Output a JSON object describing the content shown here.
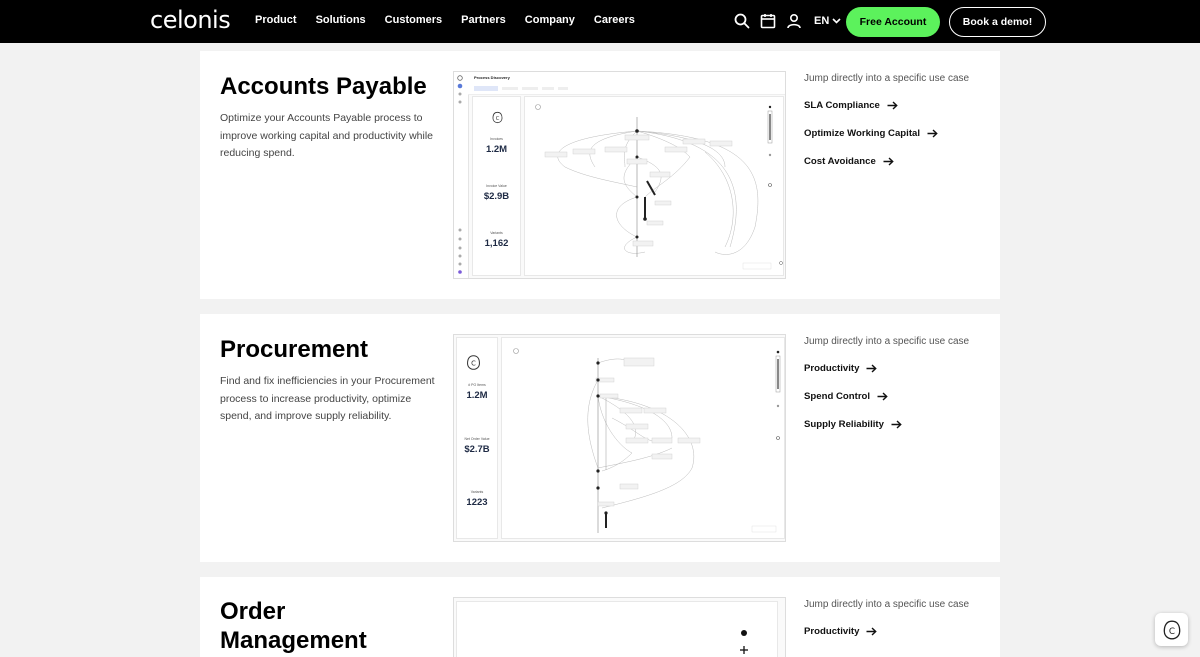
{
  "brand": {
    "logo": "celonis"
  },
  "nav": {
    "links": [
      "Product",
      "Solutions",
      "Customers",
      "Partners",
      "Company",
      "Careers"
    ],
    "lang": "EN",
    "free_account": "Free Account",
    "book_demo": "Book a demo!"
  },
  "sections": [
    {
      "title": "Accounts Payable",
      "title_line2": "",
      "description": "Optimize your Accounts Payable process to improve working capital and productivity while reducing spend.",
      "jump_label": "Jump directly into a specific use case",
      "links": [
        "SLA Compliance",
        "Optimize Working Capital",
        "Cost Avoidance"
      ],
      "screenshot": {
        "window_title": "Process Discovery",
        "metrics": [
          {
            "label": "Invoices",
            "value": "1.2M"
          },
          {
            "label": "Invoice Value",
            "value": "$2.9B"
          },
          {
            "label": "Variants",
            "value": "1,162"
          }
        ]
      }
    },
    {
      "title": "Procurement",
      "title_line2": "",
      "description": "Find and fix inefficiencies in your Procurement process to increase productivity, optimize spend, and improve supply reliability.",
      "jump_label": "Jump directly into a specific use case",
      "links": [
        "Productivity",
        "Spend Control",
        "Supply Reliability"
      ],
      "screenshot": {
        "metrics": [
          {
            "label": "# PO Items",
            "value": "1.2M"
          },
          {
            "label": "Net Order Value",
            "value": "$2.7B"
          },
          {
            "label": "Variants",
            "value": "1223"
          }
        ]
      }
    },
    {
      "title": "Order",
      "title_line2": "Management",
      "description": "",
      "jump_label": "Jump directly into a specific use case",
      "links": [
        "Productivity"
      ]
    }
  ]
}
